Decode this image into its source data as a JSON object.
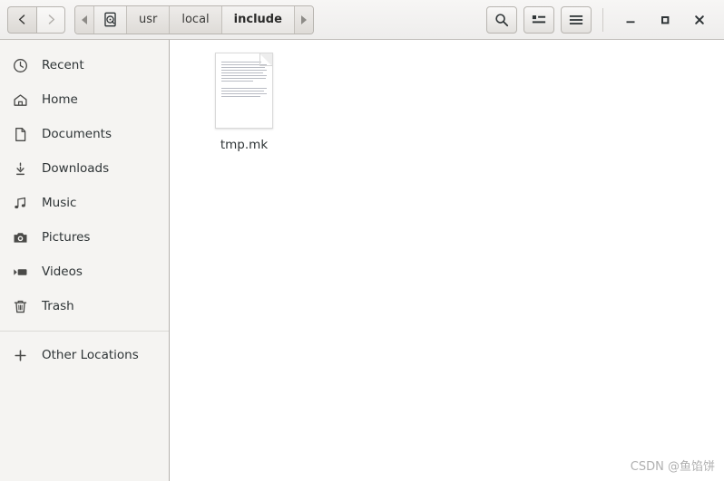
{
  "window": {
    "nav": {
      "back_label": "Back",
      "back_icon": "chevron-left-icon",
      "forward_label": "Forward",
      "forward_icon": "chevron-right-icon"
    },
    "breadcrumb": {
      "scroll_left_icon": "triangle-left-icon",
      "scroll_right_icon": "triangle-right-icon",
      "root_icon": "hard-drive-icon",
      "items": [
        {
          "label": "usr",
          "current": false
        },
        {
          "label": "local",
          "current": false
        },
        {
          "label": "include",
          "current": true
        }
      ]
    },
    "actions": {
      "search_icon": "search-icon",
      "search_label": "Search",
      "view_list_icon": "view-list-icon",
      "view_list_label": "View options",
      "menu_icon": "hamburger-menu-icon",
      "menu_label": "Main menu"
    },
    "controls": {
      "minimize_icon": "minimize-icon",
      "minimize_label": "Minimize",
      "maximize_icon": "maximize-icon",
      "maximize_label": "Maximize",
      "close_icon": "close-icon",
      "close_label": "Close"
    }
  },
  "sidebar": {
    "items": [
      {
        "label": "Recent",
        "icon": "clock-icon"
      },
      {
        "label": "Home",
        "icon": "home-icon"
      },
      {
        "label": "Documents",
        "icon": "document-icon"
      },
      {
        "label": "Downloads",
        "icon": "download-icon"
      },
      {
        "label": "Music",
        "icon": "music-note-icon"
      },
      {
        "label": "Pictures",
        "icon": "camera-icon"
      },
      {
        "label": "Videos",
        "icon": "video-icon"
      },
      {
        "label": "Trash",
        "icon": "trash-icon"
      }
    ],
    "other_locations": {
      "label": "Other Locations",
      "icon": "plus-icon"
    }
  },
  "main": {
    "files": [
      {
        "name": "tmp.mk",
        "icon": "text-file-thumbnail"
      }
    ]
  },
  "watermark": {
    "text": "CSDN @鱼馅饼"
  },
  "colors": {
    "headerbar": "#f2f1f0",
    "sidebar": "#f5f4f2",
    "content": "#ffffff",
    "border": "#b5b2ae",
    "text": "#2e3436",
    "watermark": "#b0b0b0"
  }
}
